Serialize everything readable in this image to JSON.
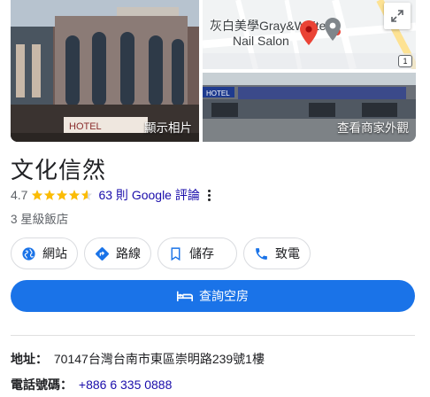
{
  "photos": {
    "main_caption": "顯示相片",
    "street_caption": "查看商家外觀",
    "map_label_line1": "灰白美學Gray&White",
    "map_label_line2": "Nail Salon",
    "map_road_badge": "1",
    "storefront_sign_main": "HOTEL",
    "storefront_sign_street": "HOTEL"
  },
  "business": {
    "name": "文化信然",
    "rating": "4.7",
    "stars": 4.7,
    "reviews_label": "63 則 Google 評論",
    "category": "3 星級飯店"
  },
  "actions": {
    "website": "網站",
    "directions": "路線",
    "save": "儲存",
    "call": "致電",
    "book": "查詢空房"
  },
  "info": {
    "address_label": "地址：",
    "address_value": "70147台灣台南市東區崇明路239號1樓",
    "phone_label": "電話號碼：",
    "phone_value": "+886 6 335 0888"
  },
  "colors": {
    "accent": "#1a73e8",
    "link": "#1a0dab",
    "star": "#fbbc04",
    "pin": "#ea4335"
  }
}
